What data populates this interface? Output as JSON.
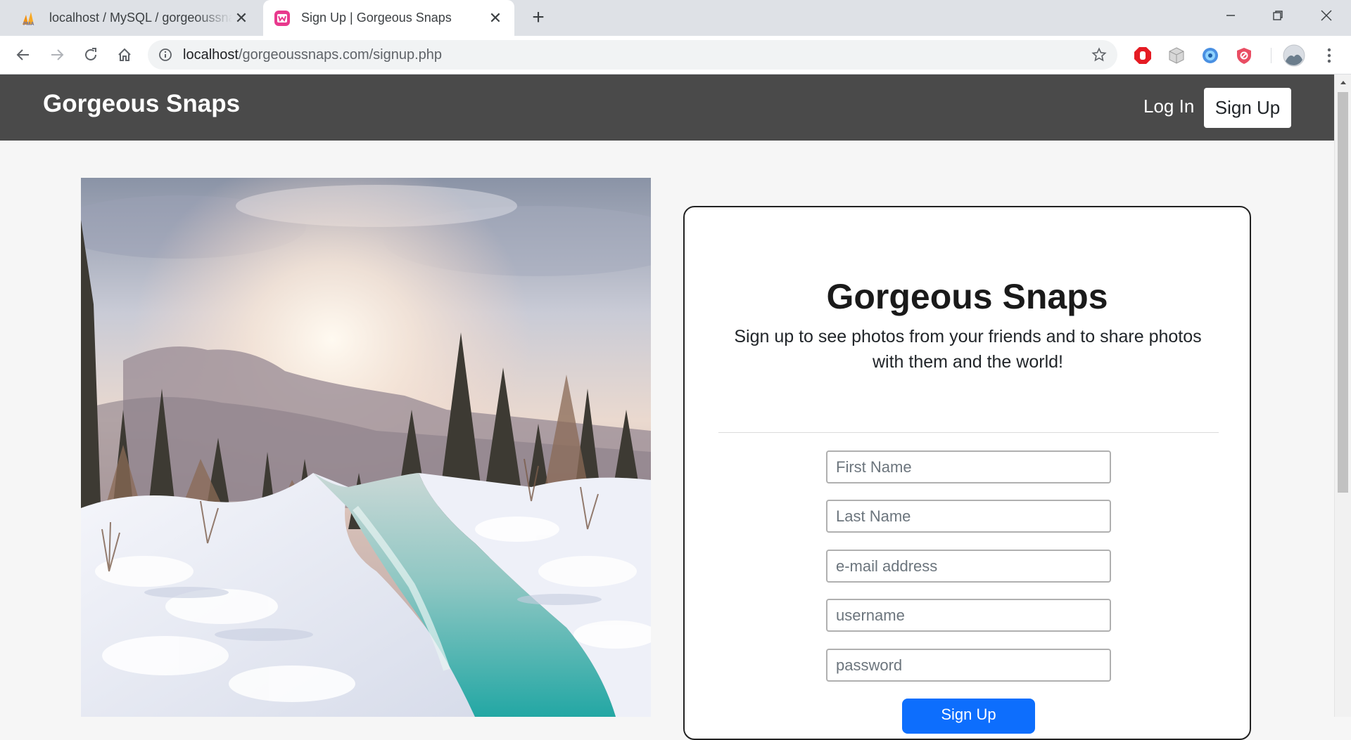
{
  "browser": {
    "tabs": [
      {
        "title": "localhost / MySQL / gorgeoussnaps",
        "active": false,
        "icon": "phpmyadmin-icon"
      },
      {
        "title": "Sign Up | Gorgeous Snaps",
        "active": true,
        "icon": "wamp-icon"
      }
    ],
    "address": {
      "host": "localhost",
      "path": "/gorgeoussnaps.com/signup.php"
    },
    "extensions": [
      "adblock-icon",
      "cube-extension-icon",
      "vpn-extension-icon",
      "shield-extension-icon",
      "profile-avatar"
    ]
  },
  "navbar": {
    "brand": "Gorgeous Snaps",
    "login": "Log In",
    "signup": "Sign Up"
  },
  "signup_card": {
    "title": "Gorgeous Snaps",
    "subtitle": "Sign up to see photos from your friends and to share photos with them and the world!",
    "fields": {
      "first_name": "First Name",
      "last_name": "Last Name",
      "email": "e-mail address",
      "username": "username",
      "password": "password"
    },
    "submit": "Sign Up"
  },
  "colors": {
    "navbar": "#4a4a4a",
    "primary": "#0d6efd",
    "page_bg": "#f6f6f6"
  }
}
